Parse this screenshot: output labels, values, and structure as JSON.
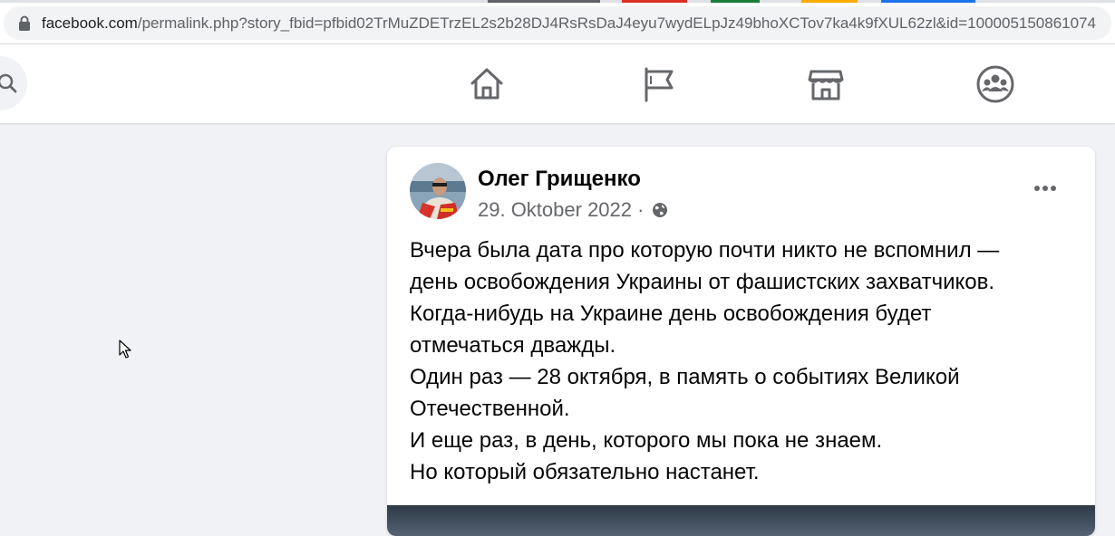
{
  "browser": {
    "url_domain": "facebook.com",
    "url_path": "/permalink.php?story_fbid=pfbid02TrMuZDETrzEL2s2b28DJ4RsRsDaJ4eyu7wydELpJz49bhoXCTov7ka4k9fXUL62zl&id=100005150861074",
    "lock_icon": "lock-icon"
  },
  "header": {
    "search_icon": "search-icon",
    "nav_tabs": [
      {
        "name": "home",
        "icon": "home-icon"
      },
      {
        "name": "pages",
        "icon": "flag-icon"
      },
      {
        "name": "marketplace",
        "icon": "marketplace-icon"
      },
      {
        "name": "groups",
        "icon": "groups-icon"
      }
    ]
  },
  "post": {
    "author": "Олег Грищенко",
    "date": "29. Oktober 2022",
    "separator": "·",
    "audience_icon": "globe-icon",
    "more_icon": "more-options-icon",
    "text_lines": [
      "Вчера была дата про которую почти никто не вспомнил —",
      "день освобождения Украины от фашистских захватчиков.",
      "Когда-нибудь на Украине день освобождения будет",
      "отмечаться дважды.",
      "Один раз — 28 октября, в память о событиях Великой",
      "Отечественной.",
      "И еще раз, в день, которого мы пока не знаем.",
      "Но который обязательно настанет."
    ]
  },
  "colors": {
    "page_background": "#f0f2f5",
    "text_primary": "#050505",
    "text_secondary": "#65676b",
    "nav_icon": "#65676b"
  }
}
